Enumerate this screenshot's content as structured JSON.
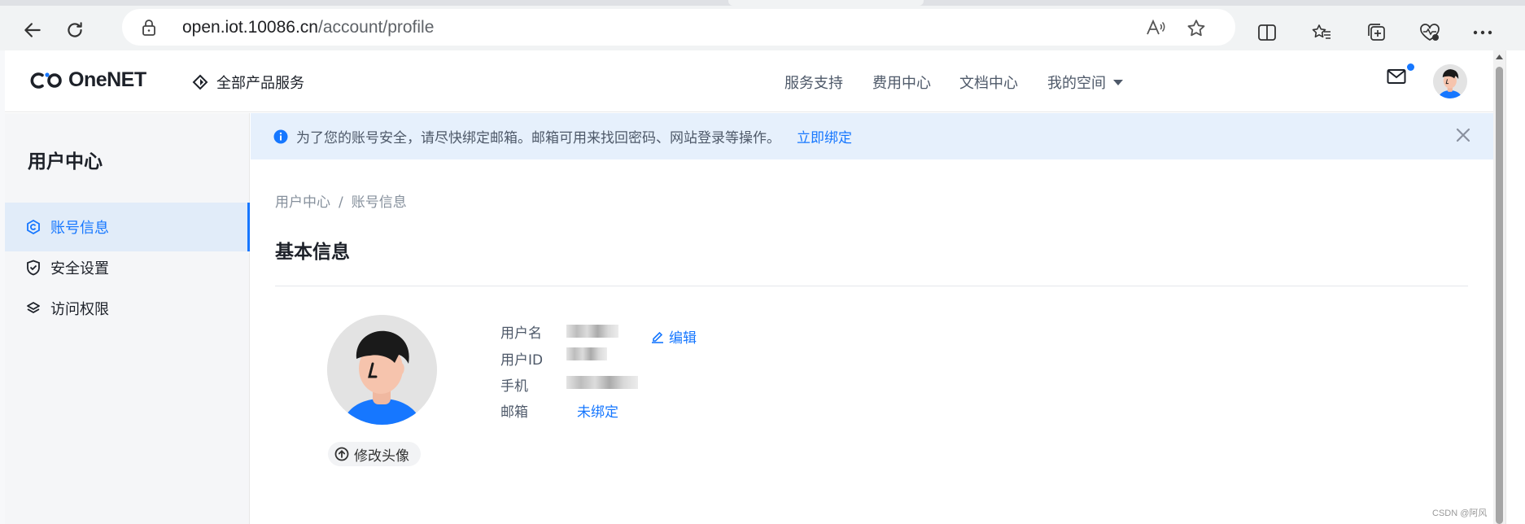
{
  "browser": {
    "url_host": "open.iot.10086.cn",
    "url_path": "/account/profile"
  },
  "header": {
    "logo_text": "OneNET",
    "all_products": "全部产品服务",
    "nav": [
      "服务支持",
      "费用中心",
      "文档中心",
      "我的空间"
    ]
  },
  "sidebar": {
    "title": "用户中心",
    "items": [
      {
        "label": "账号信息",
        "icon": "account-info-icon",
        "active": true
      },
      {
        "label": "安全设置",
        "icon": "shield-icon",
        "active": false
      },
      {
        "label": "访问权限",
        "icon": "layers-icon",
        "active": false
      }
    ]
  },
  "alert": {
    "text": "为了您的账号安全，请尽快绑定邮箱。邮箱可用来找回密码、网站登录等操作。",
    "link": "立即绑定"
  },
  "breadcrumb": {
    "root": "用户中心",
    "separator": "/",
    "current": "账号信息"
  },
  "profile": {
    "section_title": "基本信息",
    "change_avatar": "修改头像",
    "fields": {
      "username_label": "用户名",
      "edit_label": "编辑",
      "userid_label": "用户ID",
      "phone_label": "手机",
      "email_label": "邮箱",
      "email_value": "未绑定"
    }
  },
  "watermark": "CSDN @阿风",
  "colors": {
    "accent": "#1677ff",
    "alert_bg": "#e6f0fc",
    "sidebar_active_bg": "#e1ecf9"
  }
}
